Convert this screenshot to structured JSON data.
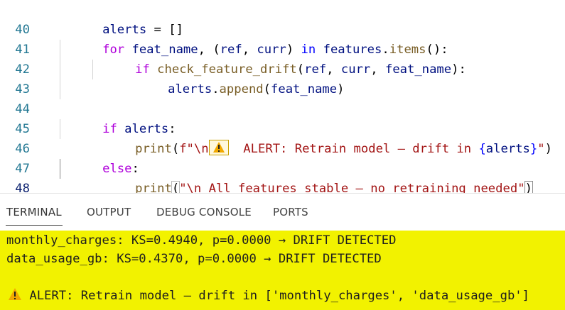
{
  "editor": {
    "lines": [
      {
        "num": "40",
        "tokens": {
          "a": "alerts",
          "b": " = []"
        }
      },
      {
        "num": "41",
        "tokens": {
          "kw1": "for",
          "a": " feat_name",
          "b": ", (",
          "c": "ref",
          "d": ", ",
          "e": "curr",
          "f": ") ",
          "kw2": "in",
          "g": " ",
          "h": "features",
          "i": ".",
          "j": "items",
          "k": "():"
        }
      },
      {
        "num": "42",
        "tokens": {
          "kw1": "if",
          "g": " ",
          "fn": "check_feature_drift",
          "b": "(",
          "c": "ref",
          "d": ", ",
          "e": "curr",
          "f": ", ",
          "h": "feat_name",
          "k": "):"
        }
      },
      {
        "num": "43",
        "tokens": {
          "a": "alerts",
          "b": ".",
          "fn": "append",
          "c": "(",
          "d": "feat_name",
          "e": ")"
        }
      },
      {
        "num": "44",
        "tokens": {}
      },
      {
        "num": "45",
        "tokens": {
          "kw1": "if",
          "a": " alerts",
          "b": ":"
        }
      },
      {
        "num": "46",
        "tokens": {
          "fn": "print",
          "b": "(",
          "c": "f\"\\n",
          "d": "  ALERT: Retrain model — drift in ",
          "e": "{",
          "f": "alerts",
          "g": "}",
          "h": "\"",
          "i": ")"
        }
      },
      {
        "num": "47",
        "tokens": {
          "kw1": "else",
          "b": ":"
        }
      },
      {
        "num": "48",
        "tokens": {
          "fn": "print",
          "b": "(",
          "c": "\"\\n All features stable — no retraining needed\"",
          "d": ")"
        }
      }
    ]
  },
  "panel": {
    "tabs": [
      "TERMINAL",
      "OUTPUT",
      "DEBUG CONSOLE",
      "PORTS"
    ],
    "terminal_lines": [
      "monthly_charges: KS=0.4940, p=0.0000 → DRIFT DETECTED",
      "data_usage_gb: KS=0.4370, p=0.0000 → DRIFT DETECTED",
      "",
      " ALERT: Retrain model — drift in ['monthly_charges', 'data_usage_gb']"
    ]
  },
  "colors": {
    "terminal_bg": "#f2f200",
    "keyword_control": "#af00db",
    "variable": "#001080",
    "function": "#795e26",
    "string": "#a31515",
    "warning": "#f2a900"
  },
  "icons": [
    "warning-icon"
  ]
}
